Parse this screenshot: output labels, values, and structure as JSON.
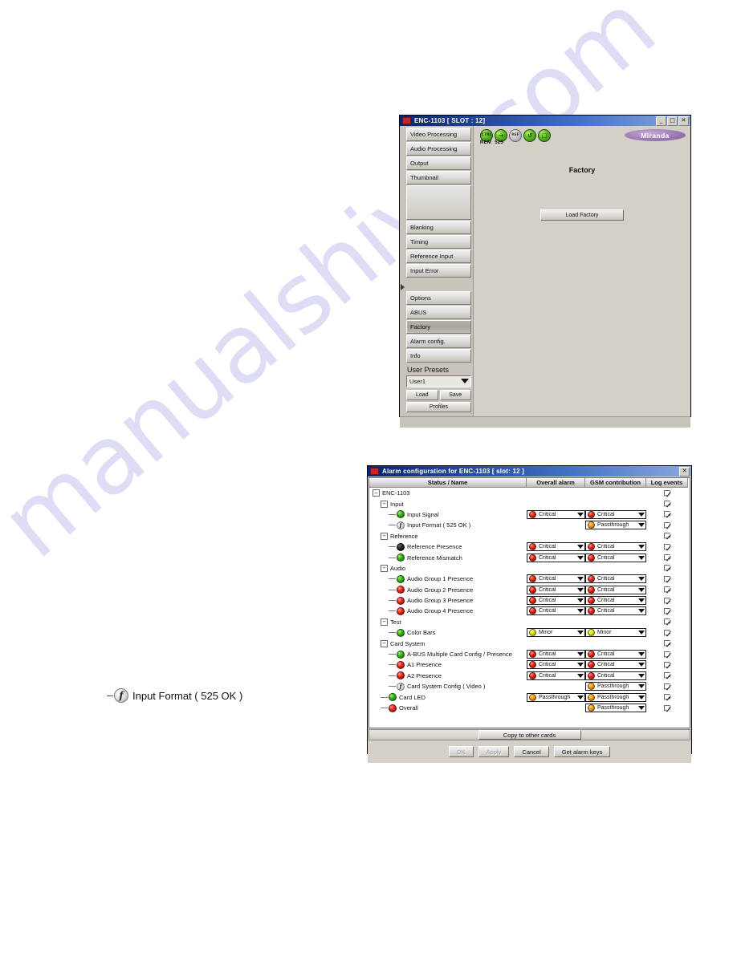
{
  "watermark": {
    "text": "manualshive.com"
  },
  "window1": {
    "title": "ENC-1103 [ SLOT : 12]",
    "title_icon": "app-icon",
    "controls": {
      "minimize": "_",
      "maximize": "□",
      "close": "✕"
    },
    "logo": "Miranda",
    "status_icons": [
      {
        "name": "ctrl-status-icon",
        "glyph": "CTRL",
        "color": "#4aab16"
      },
      {
        "name": "arrow-status-icon",
        "glyph": "→",
        "color": "#4aab16"
      },
      {
        "name": "ref-status-icon",
        "glyph": "REF",
        "color": "#9a9a9a"
      },
      {
        "name": "loop-status-icon",
        "glyph": "↺",
        "color": "#4aab16"
      },
      {
        "name": "card-status-icon",
        "glyph": "□",
        "color": "#4aab16"
      }
    ],
    "status_labels": [
      "REM",
      "525"
    ],
    "tabs": [
      {
        "label": "Video Processing",
        "selected": false
      },
      {
        "label": "Audio Processing",
        "selected": false
      },
      {
        "label": "Output",
        "selected": false
      },
      {
        "label": "Thumbnail",
        "selected": false
      },
      {
        "label": "Blanking",
        "selected": false
      },
      {
        "label": "Timing",
        "selected": false
      },
      {
        "label": "Reference Input",
        "selected": false
      },
      {
        "label": "Input Error",
        "selected": false
      },
      {
        "label": "Options",
        "selected": false
      },
      {
        "label": "ABUS",
        "selected": false
      },
      {
        "label": "Factory",
        "selected": true
      },
      {
        "label": "Alarm config.",
        "selected": false
      },
      {
        "label": "Info",
        "selected": false
      }
    ],
    "presets": {
      "label": "User Presets",
      "selected": "User1",
      "load_label": "Load",
      "save_label": "Save",
      "profiles_label": "Profiles"
    },
    "panel": {
      "title": "Factory",
      "load_factory_label": "Load Factory"
    }
  },
  "window2": {
    "title": "Alarm configuration for ENC-1103 [ slot: 12 ]",
    "controls": {
      "close": "✕"
    },
    "columns": [
      "Status / Name",
      "Overall alarm",
      "GSM contribution",
      "Log events"
    ],
    "rows": [
      {
        "name": "ENC-1103",
        "indent": 0,
        "node": "expander",
        "expander": "−",
        "led": null,
        "overall": null,
        "gsm": null,
        "log": true
      },
      {
        "name": "Input",
        "indent": 1,
        "node": "expander",
        "expander": "−",
        "led": null,
        "overall": null,
        "gsm": null,
        "log": true
      },
      {
        "name": "Input Signal",
        "indent": 2,
        "node": "leaf",
        "expander": null,
        "led": "green",
        "overall": "Critical",
        "gsm": "Critical",
        "log": true
      },
      {
        "name": "Input Format ( 525 OK )",
        "indent": 2,
        "node": "leaf",
        "expander": null,
        "led": "info",
        "overall": null,
        "gsm": "Passthrough",
        "log": true
      },
      {
        "name": "Reference",
        "indent": 1,
        "node": "expander",
        "expander": "−",
        "led": null,
        "overall": null,
        "gsm": null,
        "log": true
      },
      {
        "name": "Reference Presence",
        "indent": 2,
        "node": "leaf",
        "expander": null,
        "led": "black",
        "overall": "Critical",
        "gsm": "Critical",
        "log": true
      },
      {
        "name": "Reference Mismatch",
        "indent": 2,
        "node": "leaf",
        "expander": null,
        "led": "green",
        "overall": "Critical",
        "gsm": "Critical",
        "log": true
      },
      {
        "name": "Audio",
        "indent": 1,
        "node": "expander",
        "expander": "−",
        "led": null,
        "overall": null,
        "gsm": null,
        "log": true
      },
      {
        "name": "Audio Group 1 Presence",
        "indent": 2,
        "node": "leaf",
        "expander": null,
        "led": "green",
        "overall": "Critical",
        "gsm": "Critical",
        "log": true
      },
      {
        "name": "Audio Group 2 Presence",
        "indent": 2,
        "node": "leaf",
        "expander": null,
        "led": "red",
        "overall": "Critical",
        "gsm": "Critical",
        "log": true
      },
      {
        "name": "Audio Group 3 Presence",
        "indent": 2,
        "node": "leaf",
        "expander": null,
        "led": "red",
        "overall": "Critical",
        "gsm": "Critical",
        "log": true
      },
      {
        "name": "Audio Group 4 Presence",
        "indent": 2,
        "node": "leaf",
        "expander": null,
        "led": "red",
        "overall": "Critical",
        "gsm": "Critical",
        "log": true
      },
      {
        "name": "Test",
        "indent": 1,
        "node": "expander",
        "expander": "−",
        "led": null,
        "overall": null,
        "gsm": null,
        "log": true
      },
      {
        "name": "Color Bars",
        "indent": 2,
        "node": "leaf",
        "expander": null,
        "led": "green",
        "overall": "Minor",
        "gsm": "Minor",
        "log": true
      },
      {
        "name": "Card System",
        "indent": 1,
        "node": "expander",
        "expander": "−",
        "led": null,
        "overall": null,
        "gsm": null,
        "log": true
      },
      {
        "name": "A-BUS Multiple Card Config / Presence",
        "indent": 2,
        "node": "leaf",
        "expander": null,
        "led": "green",
        "overall": "Critical",
        "gsm": "Critical",
        "log": true
      },
      {
        "name": "A1 Presence",
        "indent": 2,
        "node": "leaf",
        "expander": null,
        "led": "red",
        "overall": "Critical",
        "gsm": "Critical",
        "log": true
      },
      {
        "name": "A2 Presence",
        "indent": 2,
        "node": "leaf",
        "expander": null,
        "led": "red",
        "overall": "Critical",
        "gsm": "Critical",
        "log": true
      },
      {
        "name": "Card System Config ( Video )",
        "indent": 2,
        "node": "leaf",
        "expander": null,
        "led": "info",
        "overall": null,
        "gsm": "Passthrough",
        "log": true
      },
      {
        "name": "Card LED",
        "indent": 1,
        "node": "leaf",
        "expander": null,
        "led": "green",
        "overall": "Passthrough",
        "gsm": "Passthrough",
        "log": true
      },
      {
        "name": "Overall",
        "indent": 1,
        "node": "leaf",
        "expander": null,
        "led": "red",
        "overall": null,
        "gsm": "Passthrough",
        "log": true
      }
    ],
    "copy_button": "Copy to other cards",
    "footer_buttons": [
      {
        "label": "OK",
        "disabled": true
      },
      {
        "label": "Apply",
        "disabled": true
      },
      {
        "label": "Cancel",
        "disabled": false
      },
      {
        "label": "Get alarm keys",
        "disabled": false
      }
    ]
  },
  "callout": {
    "icon": "format-info-icon",
    "text": "Input Format ( 525 OK )"
  },
  "colors": {
    "critical": "#e12314",
    "minor": "#dbe11a",
    "passthrough": "#f29a12",
    "ok_green": "#2fae12",
    "titlebar": "#0a246a",
    "brand_purple": "#9e7ab5",
    "watermark": "#c9c9ef"
  }
}
